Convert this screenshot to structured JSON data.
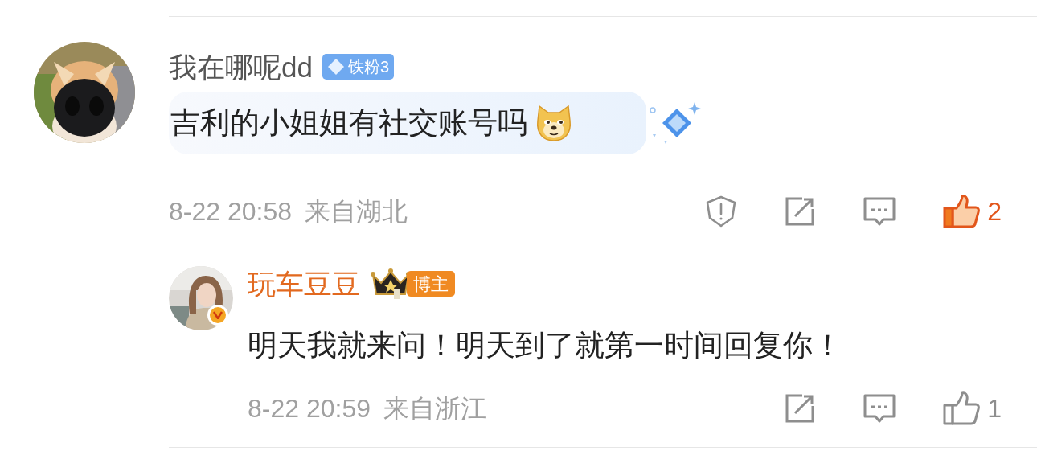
{
  "comments": [
    {
      "user": {
        "name": "我在哪呢dd",
        "badge": "铁粉3"
      },
      "text": "吉利的小姐姐有社交账号吗",
      "emoji": true,
      "bubble": true,
      "time": "8-22 20:58",
      "location": "来自湖北",
      "actions": [
        {
          "kind": "report"
        },
        {
          "kind": "share"
        },
        {
          "kind": "comment"
        }
      ],
      "likes": "2",
      "liked": true,
      "replies": [
        {
          "user": {
            "name": "玩车豆豆",
            "role": "博主",
            "verified": true
          },
          "text": "明天我就来问！明天到了就第一时间回复你！",
          "time": "8-22 20:59",
          "location": "来自浙江",
          "actions": [
            {
              "kind": "share"
            },
            {
              "kind": "comment"
            }
          ],
          "likes": "1",
          "liked": false
        }
      ]
    }
  ]
}
